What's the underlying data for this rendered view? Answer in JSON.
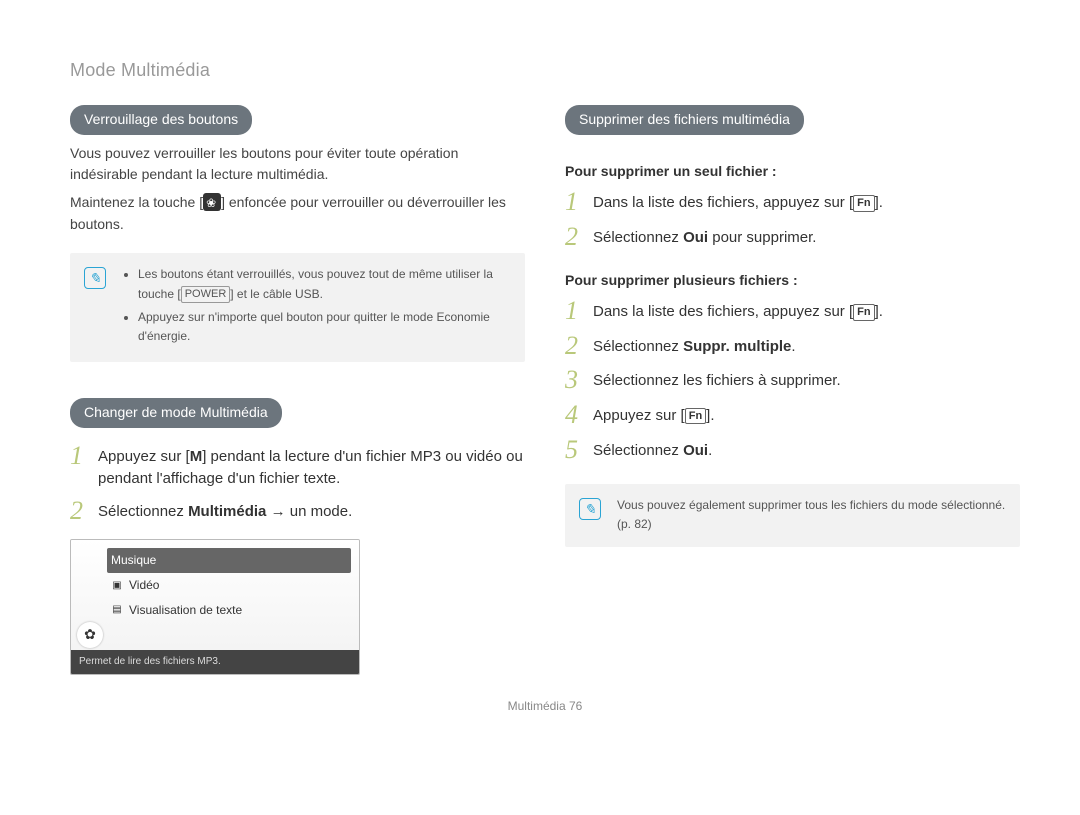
{
  "page_title": "Mode Multimédia",
  "footer_label": "Multimédia",
  "footer_page": "76",
  "left": {
    "section1": {
      "heading": "Verrouillage des boutons",
      "p1": "Vous pouvez verrouiller les boutons pour éviter toute opération indésirable pendant la lecture multimédia.",
      "p2a": "Maintenez la touche [",
      "p2b": "] enfoncée pour verrouiller ou déverrouiller les boutons.",
      "note1_a": "Les boutons étant verrouillés, vous pouvez tout de même utiliser la touche [",
      "note1_key": "POWER",
      "note1_b": "] et le câble USB.",
      "note2": "Appuyez sur n'importe quel bouton pour quitter le mode Economie d'énergie."
    },
    "section2": {
      "heading": "Changer de mode Multimédia",
      "step1_a": "Appuyez sur [",
      "step1_key": "M",
      "step1_b": "] pendant la lecture d'un fichier MP3 ou vidéo ou pendant l'affichage d'un fichier texte.",
      "step2_a": "Sélectionnez ",
      "step2_b": "Multimédia",
      "step2_c": " → un mode.",
      "menu": {
        "items": [
          "Musique",
          "Vidéo",
          "Visualisation de texte"
        ],
        "caption": "Permet de lire des fichiers MP3."
      }
    }
  },
  "right": {
    "heading": "Supprimer des fichiers multimédia",
    "sub1": "Pour supprimer un seul fichier :",
    "a_step1_a": "Dans la liste des fichiers, appuyez sur [",
    "a_step1_fn": "Fn",
    "a_step1_b": "].",
    "a_step2_a": "Sélectionnez ",
    "a_step2_b": "Oui",
    "a_step2_c": " pour supprimer.",
    "sub2": "Pour supprimer plusieurs fichiers :",
    "b_step1_a": "Dans la liste des fichiers, appuyez sur [",
    "b_step1_fn": "Fn",
    "b_step1_b": "].",
    "b_step2_a": "Sélectionnez ",
    "b_step2_b": "Suppr. multiple",
    "b_step2_c": ".",
    "b_step3": "Sélectionnez les fichiers à supprimer.",
    "b_step4_a": "Appuyez sur [",
    "b_step4_fn": "Fn",
    "b_step4_b": "].",
    "b_step5_a": "Sélectionnez ",
    "b_step5_b": "Oui",
    "b_step5_c": ".",
    "note": "Vous pouvez également supprimer tous les fichiers du mode sélectionné. (p. 82)"
  }
}
